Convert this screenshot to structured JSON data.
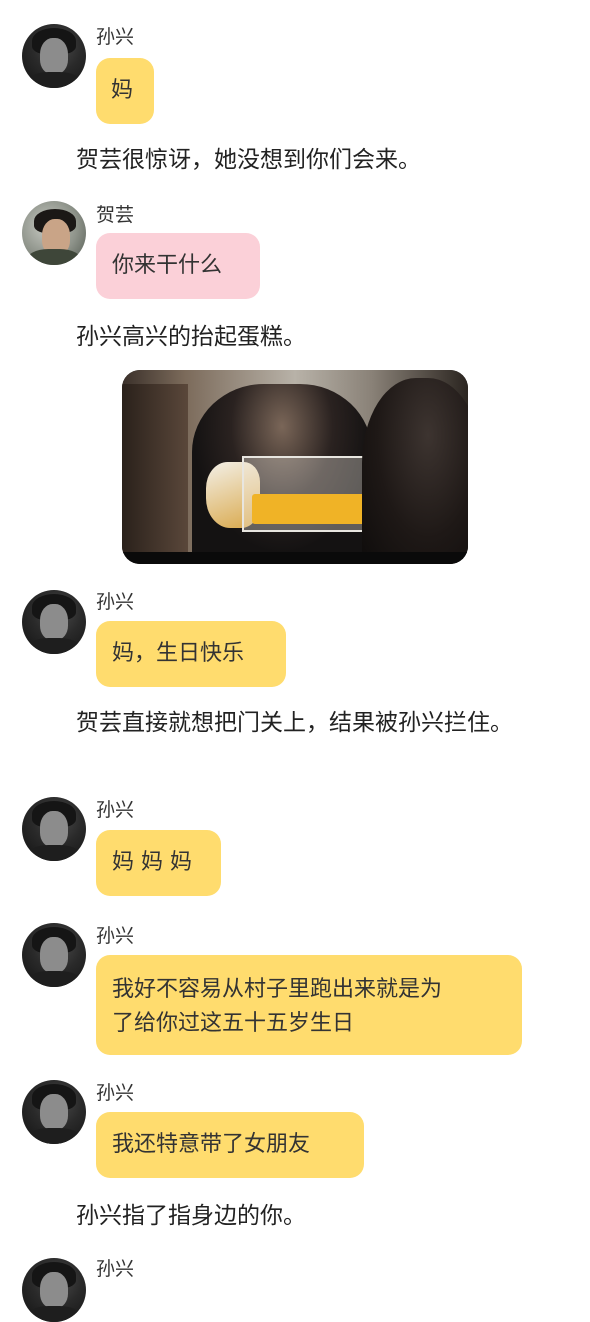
{
  "messages": [
    {
      "speaker": "孙兴",
      "text": "妈"
    },
    {
      "speaker": "贺芸",
      "text": "你来干什么"
    },
    {
      "speaker": "孙兴",
      "text": "妈，生日快乐"
    },
    {
      "speaker": "孙兴",
      "text": "妈 妈 妈"
    },
    {
      "speaker": "孙兴",
      "text_line1": "我好不容易从村子里跑出来就是为",
      "text_line2": "了给你过这五十五岁生日"
    },
    {
      "speaker": "孙兴",
      "text": "我还特意带了女朋友"
    },
    {
      "speaker": "孙兴"
    }
  ],
  "narration": [
    "贺芸很惊讶，她没想到你们会来。",
    "孙兴高兴的抬起蛋糕。",
    "贺芸直接就想把门关上，结果被孙兴拦住。",
    "孙兴指了指身边的你。"
  ],
  "colors": {
    "sunxing_bubble": "#ffdc6e",
    "heyun_bubble": "#fbd0d8"
  }
}
